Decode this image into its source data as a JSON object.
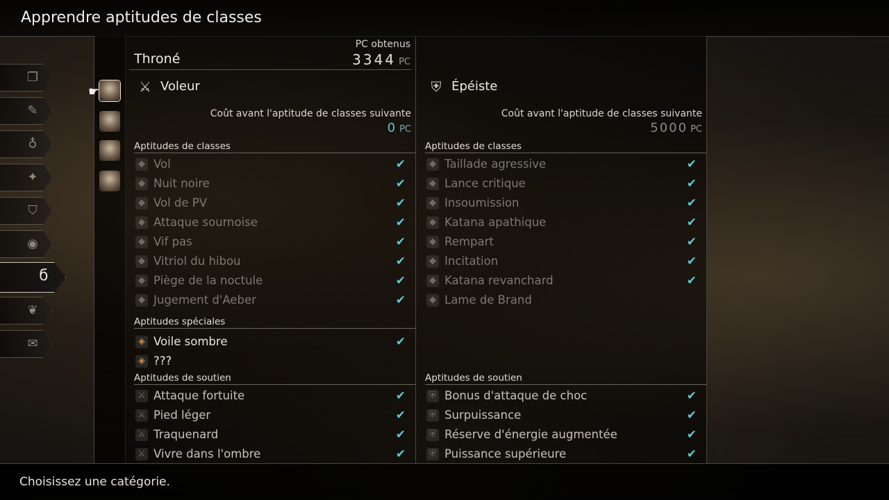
{
  "header": {
    "title": "Apprendre aptitudes de classes"
  },
  "categories": [
    {
      "icon": "book-icon"
    },
    {
      "icon": "feather-icon"
    },
    {
      "icon": "potion-icon"
    },
    {
      "icon": "sparkle-icon"
    },
    {
      "icon": "shield-icon"
    },
    {
      "icon": "orb-icon"
    },
    {
      "icon": "curl-icon",
      "active": true
    },
    {
      "icon": "leaf-icon"
    },
    {
      "icon": "scroll-icon"
    }
  ],
  "character": {
    "name": "Throné",
    "pc_label": "PC obtenus",
    "pc_value": "3344",
    "pc_unit": "PC"
  },
  "left_job": {
    "name": "Voleur",
    "cost_label": "Coût avant l'aptitude de classes suivante",
    "cost_value": "0",
    "cost_unit": "PC",
    "class_header": "Aptitudes de classes",
    "class_skills": [
      {
        "name": "Vol",
        "learned": true
      },
      {
        "name": "Nuit noire",
        "learned": true
      },
      {
        "name": "Vol de PV",
        "learned": true
      },
      {
        "name": "Attaque sournoise",
        "learned": true
      },
      {
        "name": "Vif pas",
        "learned": true
      },
      {
        "name": "Vitriol du hibou",
        "learned": true
      },
      {
        "name": "Piège de la noctule",
        "learned": true
      },
      {
        "name": "Jugement d'Aeber",
        "learned": true
      }
    ],
    "special_header": "Aptitudes spéciales",
    "special_skills": [
      {
        "name": "Voile sombre",
        "learned": true
      },
      {
        "name": "???",
        "learned": false
      }
    ],
    "support_header": "Aptitudes de soutien",
    "support_skills": [
      {
        "name": "Attaque fortuite",
        "learned": true
      },
      {
        "name": "Pied léger",
        "learned": true
      },
      {
        "name": "Traquenard",
        "learned": true
      },
      {
        "name": "Vivre dans l'ombre",
        "learned": true
      }
    ]
  },
  "right_job": {
    "name": "Épéiste",
    "cost_label": "Coût avant l'aptitude de classes suivante",
    "cost_value": "5000",
    "cost_unit": "PC",
    "class_header": "Aptitudes de classes",
    "class_skills": [
      {
        "name": "Taillade agressive",
        "learned": true
      },
      {
        "name": "Lance critique",
        "learned": true
      },
      {
        "name": "Insoumission",
        "learned": true
      },
      {
        "name": "Katana apathique",
        "learned": true
      },
      {
        "name": "Rempart",
        "learned": true
      },
      {
        "name": "Incitation",
        "learned": true
      },
      {
        "name": "Katana revanchard",
        "learned": true
      },
      {
        "name": "Lame de Brand",
        "learned": false
      }
    ],
    "support_header": "Aptitudes de soutien",
    "support_skills": [
      {
        "name": "Bonus d'attaque de choc",
        "learned": true
      },
      {
        "name": "Surpuissance",
        "learned": true
      },
      {
        "name": "Réserve d'énergie augmentée",
        "learned": true
      },
      {
        "name": "Puissance supérieure",
        "learned": true
      }
    ]
  },
  "check_glyph": "✔",
  "footer": {
    "hint": "Choisissez une catégorie."
  }
}
